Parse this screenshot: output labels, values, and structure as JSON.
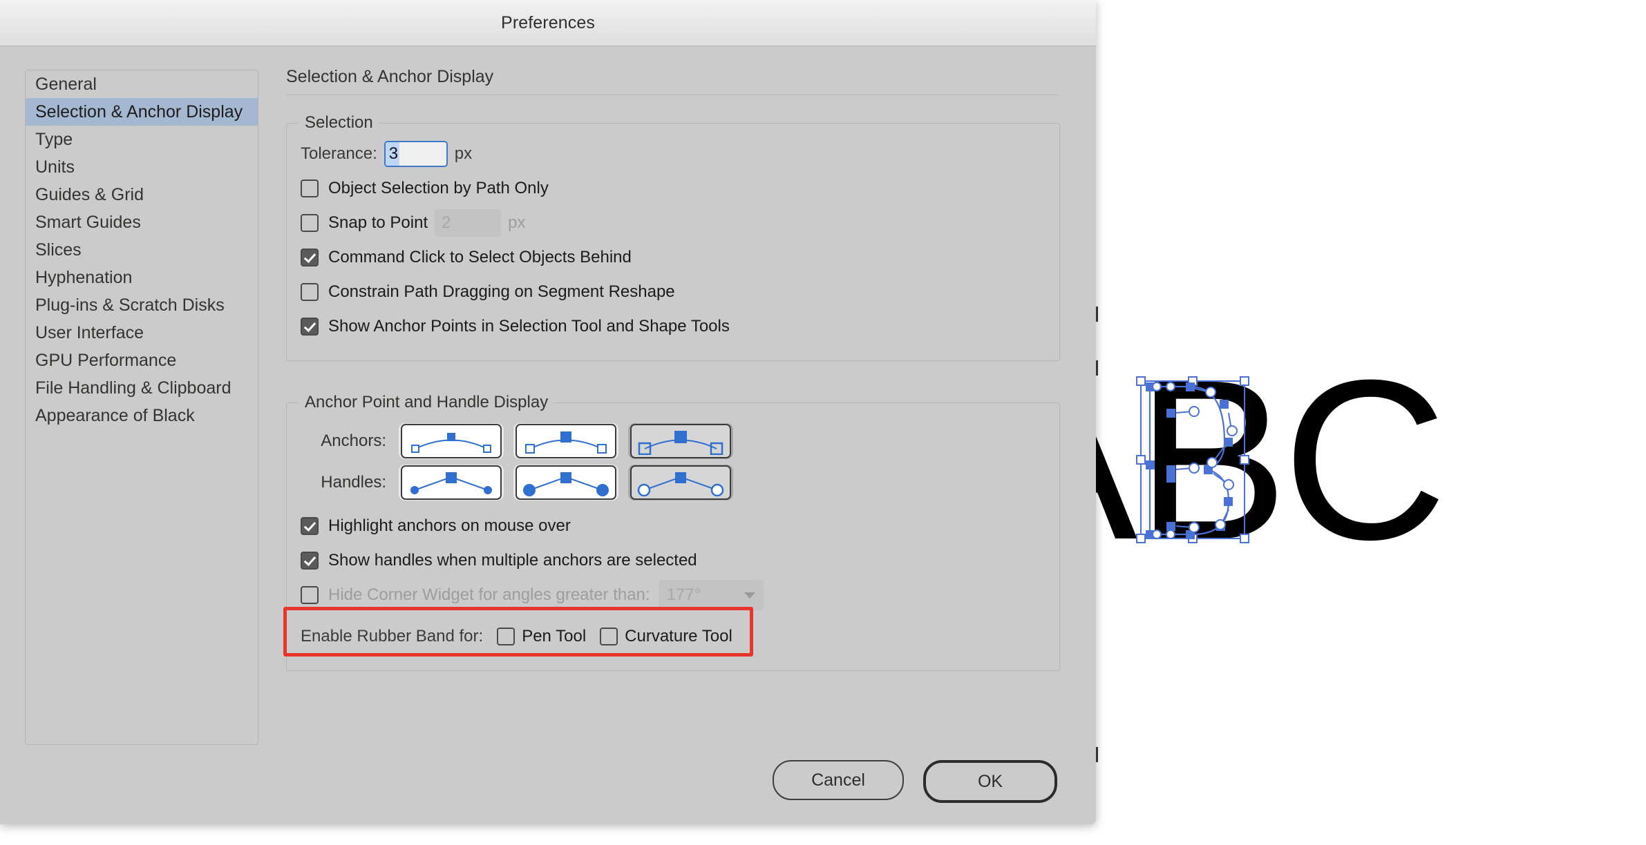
{
  "window": {
    "title": "Preferences"
  },
  "sidebar": {
    "items": [
      {
        "label": "General",
        "selected": false
      },
      {
        "label": "Selection & Anchor Display",
        "selected": true
      },
      {
        "label": "Type",
        "selected": false
      },
      {
        "label": "Units",
        "selected": false
      },
      {
        "label": "Guides & Grid",
        "selected": false
      },
      {
        "label": "Smart Guides",
        "selected": false
      },
      {
        "label": "Slices",
        "selected": false
      },
      {
        "label": "Hyphenation",
        "selected": false
      },
      {
        "label": "Plug-ins & Scratch Disks",
        "selected": false
      },
      {
        "label": "User Interface",
        "selected": false
      },
      {
        "label": "GPU Performance",
        "selected": false
      },
      {
        "label": "File Handling & Clipboard",
        "selected": false
      },
      {
        "label": "Appearance of Black",
        "selected": false
      }
    ]
  },
  "pane": {
    "title": "Selection & Anchor Display",
    "selection_group": {
      "legend": "Selection",
      "tolerance_label": "Tolerance:",
      "tolerance_value": "3",
      "tolerance_unit": "px",
      "checkboxes": [
        {
          "label": "Object Selection by Path Only",
          "checked": false
        },
        {
          "label": "Snap to Point",
          "checked": false
        },
        {
          "label": "Command Click to Select Objects Behind",
          "checked": true
        },
        {
          "label": "Constrain Path Dragging on Segment Reshape",
          "checked": false
        },
        {
          "label": "Show Anchor Points in Selection Tool and Shape Tools",
          "checked": true
        }
      ],
      "snap_value": "2",
      "snap_unit": "px"
    },
    "anchor_group": {
      "legend": "Anchor Point and Handle Display",
      "anchors_label": "Anchors:",
      "anchors_options": [
        {
          "name": "anchors-small",
          "selected": false
        },
        {
          "name": "anchors-medium",
          "selected": false
        },
        {
          "name": "anchors-large",
          "selected": true
        }
      ],
      "handles_label": "Handles:",
      "handles_options": [
        {
          "name": "handles-small-solid",
          "selected": false
        },
        {
          "name": "handles-large-solid",
          "selected": false
        },
        {
          "name": "handles-hollow",
          "selected": true
        }
      ],
      "checkboxes": [
        {
          "label": "Highlight anchors on mouse over",
          "checked": true
        },
        {
          "label": "Show handles when multiple anchors are selected",
          "checked": true
        },
        {
          "label": "Hide Corner Widget for angles greater than:",
          "checked": false
        }
      ],
      "corner_angle_value": "177°",
      "rubber_band_label": "Enable Rubber Band for:",
      "rubber_band_options": [
        {
          "label": "Pen Tool",
          "checked": false
        },
        {
          "label": "Curvature Tool",
          "checked": false
        }
      ]
    }
  },
  "buttons": {
    "cancel": "Cancel",
    "ok": "OK"
  },
  "annotation": {
    "color": "#e8352b",
    "target": "Show handles when multiple anchors are selected"
  },
  "artwork": {
    "letters": [
      "A",
      "B",
      "C"
    ],
    "selected_letter": "B",
    "selection_color": "#4a72d6",
    "text_color": "#000000"
  },
  "colors": {
    "dialog_bg": "#cbcbcb",
    "sidebar_selected": "#a5b8d2",
    "focus_blue": "#4178c8",
    "accent_blue": "#2f6fd0"
  }
}
